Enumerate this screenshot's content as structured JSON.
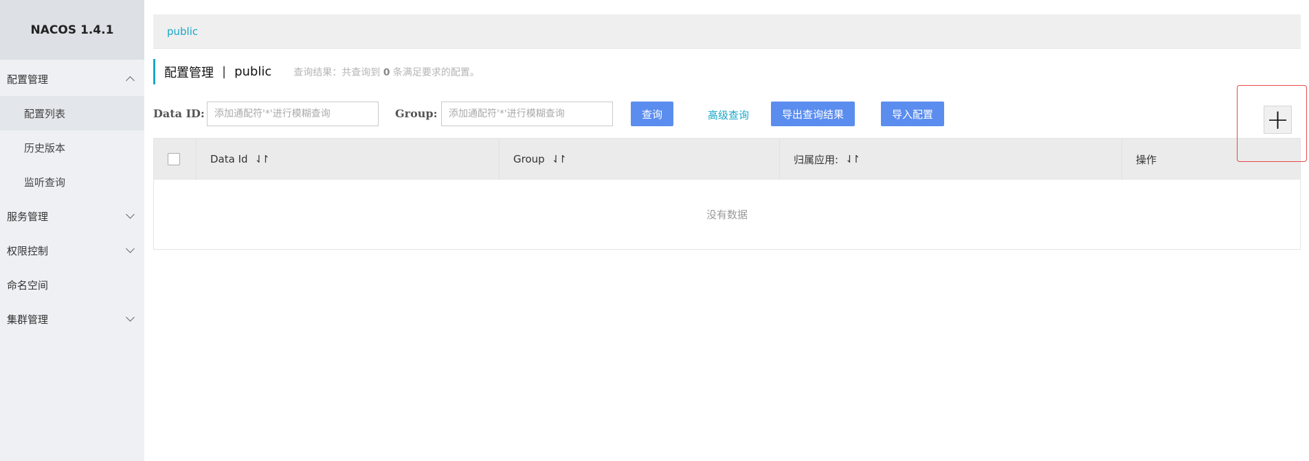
{
  "app": {
    "title": "NACOS 1.4.1"
  },
  "sidebar": {
    "config_mgmt": {
      "label": "配置管理"
    },
    "config_list": {
      "label": "配置列表"
    },
    "history": {
      "label": "历史版本"
    },
    "listener": {
      "label": "监听查询"
    },
    "service_mgmt": {
      "label": "服务管理"
    },
    "auth_control": {
      "label": "权限控制"
    },
    "namespace": {
      "label": "命名空间"
    },
    "cluster_mgmt": {
      "label": "集群管理"
    }
  },
  "namespace_bar": {
    "current": "public"
  },
  "header": {
    "title": "配置管理",
    "separator": "|",
    "namespace": "public",
    "result_prefix": "查询结果：共查询到",
    "result_count": "0",
    "result_suffix": "条满足要求的配置。"
  },
  "search": {
    "data_id_label": "Data ID:",
    "data_id_placeholder": "添加通配符'*'进行模糊查询",
    "group_label": "Group:",
    "group_placeholder": "添加通配符'*'进行模糊查询",
    "query_button": "查询",
    "advanced_query": "高级查询",
    "export_button": "导出查询结果",
    "import_button": "导入配置"
  },
  "table": {
    "columns": [
      "Data Id",
      "Group",
      "归属应用:",
      "操作"
    ],
    "sort_icon": "⇃↾",
    "empty_text": "没有数据"
  },
  "add_button": {
    "label": "+"
  },
  "colors": {
    "accent": "#17a7c8",
    "primary_button": "#5b8def",
    "highlight_border": "#e94545"
  }
}
